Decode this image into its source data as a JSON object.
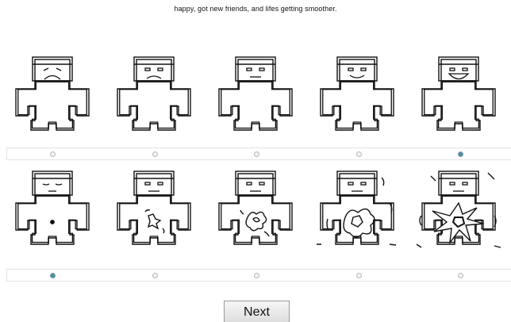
{
  "prompt_text": "happy, got new friends, and lifes getting smoother.",
  "scale_rows": [
    {
      "items": [
        {
          "icon": "sad-figure-icon",
          "face": "sad",
          "selected": false
        },
        {
          "icon": "slightly-sad-figure-icon",
          "face": "slightly-sad",
          "selected": false
        },
        {
          "icon": "neutral-figure-icon",
          "face": "neutral",
          "selected": false
        },
        {
          "icon": "smiling-figure-icon",
          "face": "smile",
          "selected": false
        },
        {
          "icon": "very-happy-figure-icon",
          "face": "big-smile",
          "selected": true
        }
      ]
    },
    {
      "items": [
        {
          "icon": "calm-figure-icon",
          "arousal": 1,
          "selected": true
        },
        {
          "icon": "mildly-aroused-figure-icon",
          "arousal": 2,
          "selected": false
        },
        {
          "icon": "aroused-figure-icon",
          "arousal": 3,
          "selected": false
        },
        {
          "icon": "very-aroused-figure-icon",
          "arousal": 4,
          "selected": false
        },
        {
          "icon": "extremely-aroused-figure-icon",
          "arousal": 5,
          "selected": false
        }
      ]
    }
  ],
  "next_label": "Next",
  "colors": {
    "selected_radio": "#4d8ea0",
    "line": "#111111"
  }
}
